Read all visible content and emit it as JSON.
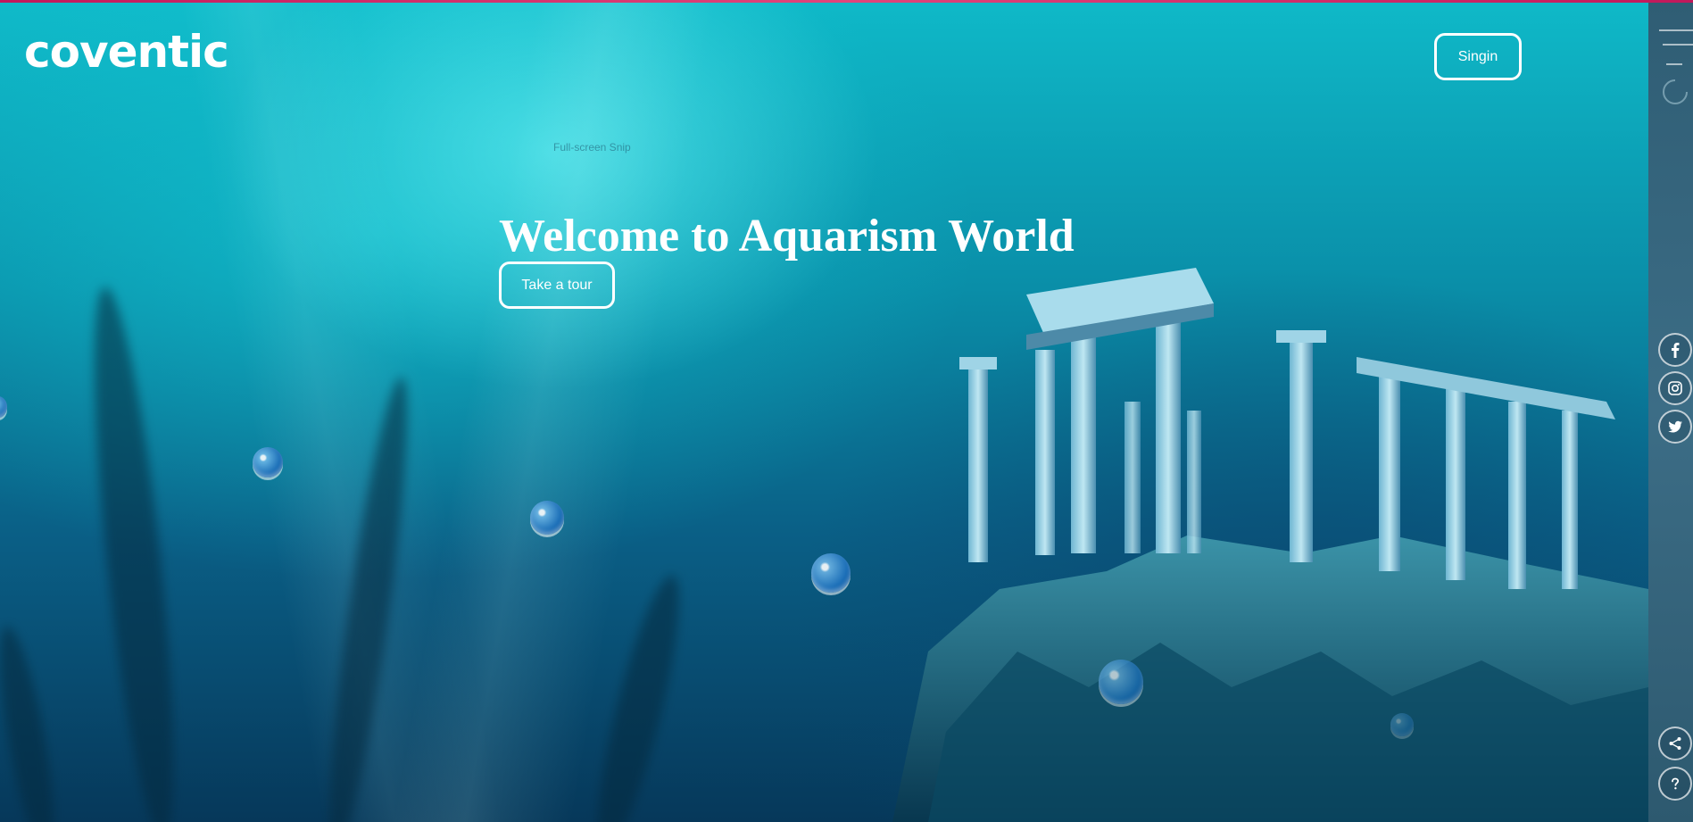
{
  "header": {
    "logo_text": "coventic",
    "signin_label": "Singin"
  },
  "overlay": {
    "snip_text": "Full-screen Snip"
  },
  "hero": {
    "title": "Welcome to Aquarism World",
    "tour_label": "Take a tour"
  },
  "sidebar": {
    "menu_icon": "hamburger-menu-icon",
    "loading_icon": "spinner-icon",
    "social": [
      "facebook-icon",
      "instagram-icon",
      "twitter-icon"
    ],
    "bottom": [
      "share-icon",
      "help-icon"
    ]
  },
  "colors": {
    "top_strip": "#c2185b",
    "sidebar": "#3c6d86",
    "text": "#ffffff"
  }
}
